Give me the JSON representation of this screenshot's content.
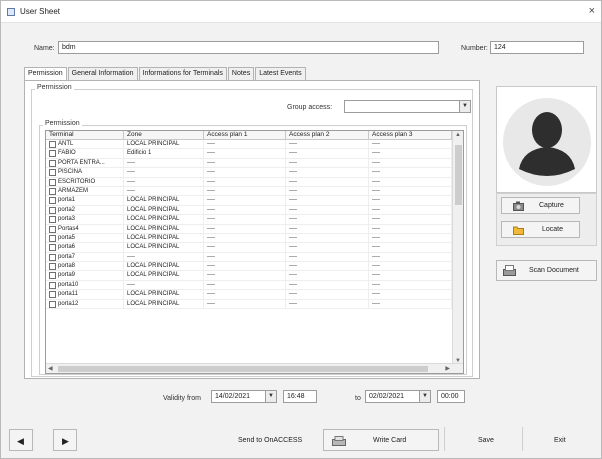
{
  "window": {
    "title": "User Sheet",
    "close_glyph": "×"
  },
  "header": {
    "name_label": "Name:",
    "name_value": "bdm",
    "number_label": "Number:",
    "number_value": "124"
  },
  "tabs": [
    {
      "label": "Permission"
    },
    {
      "label": "General Information"
    },
    {
      "label": "Informations for Terminals"
    },
    {
      "label": "Notes"
    },
    {
      "label": "Latest Events"
    }
  ],
  "permission": {
    "group_caption": "Permission",
    "group_access_label": "Group access:",
    "group_access_value": "",
    "inner_caption": "Permission",
    "columns": [
      "Terminal",
      "Zone",
      "Access plan 1",
      "Access plan 2",
      "Access plan 3"
    ],
    "rows": [
      {
        "terminal": "ANTL",
        "zone": "LOCAL PRINCIPAL",
        "p1": "----",
        "p2": "----",
        "p3": "----"
      },
      {
        "terminal": "FABIO",
        "zone": "Edificio 1",
        "p1": "----",
        "p2": "----",
        "p3": "----"
      },
      {
        "terminal": "PORTA ENTRA...",
        "zone": "----",
        "p1": "----",
        "p2": "----",
        "p3": "----"
      },
      {
        "terminal": "PISCINA",
        "zone": "----",
        "p1": "----",
        "p2": "----",
        "p3": "----"
      },
      {
        "terminal": "ESCRITORIO",
        "zone": "----",
        "p1": "----",
        "p2": "----",
        "p3": "----"
      },
      {
        "terminal": "ARMAZEM",
        "zone": "----",
        "p1": "----",
        "p2": "----",
        "p3": "----"
      },
      {
        "terminal": "porta1",
        "zone": "LOCAL PRINCIPAL",
        "p1": "----",
        "p2": "----",
        "p3": "----"
      },
      {
        "terminal": "porta2",
        "zone": "LOCAL PRINCIPAL",
        "p1": "----",
        "p2": "----",
        "p3": "----"
      },
      {
        "terminal": "porta3",
        "zone": "LOCAL PRINCIPAL",
        "p1": "----",
        "p2": "----",
        "p3": "----"
      },
      {
        "terminal": "Portas4",
        "zone": "LOCAL PRINCIPAL",
        "p1": "----",
        "p2": "----",
        "p3": "----"
      },
      {
        "terminal": "porta5",
        "zone": "LOCAL PRINCIPAL",
        "p1": "----",
        "p2": "----",
        "p3": "----"
      },
      {
        "terminal": "porta6",
        "zone": "LOCAL PRINCIPAL",
        "p1": "----",
        "p2": "----",
        "p3": "----"
      },
      {
        "terminal": "porta7",
        "zone": "----",
        "p1": "----",
        "p2": "----",
        "p3": "----"
      },
      {
        "terminal": "porta8",
        "zone": "LOCAL PRINCIPAL",
        "p1": "----",
        "p2": "----",
        "p3": "----"
      },
      {
        "terminal": "porta9",
        "zone": "LOCAL PRINCIPAL",
        "p1": "----",
        "p2": "----",
        "p3": "----"
      },
      {
        "terminal": "porta10",
        "zone": "----",
        "p1": "----",
        "p2": "----",
        "p3": "----"
      },
      {
        "terminal": "porta11",
        "zone": "LOCAL PRINCIPAL",
        "p1": "----",
        "p2": "----",
        "p3": "----"
      },
      {
        "terminal": "porta12",
        "zone": "LOCAL PRINCIPAL",
        "p1": "----",
        "p2": "----",
        "p3": "----"
      }
    ]
  },
  "validity": {
    "from_label": "Validity from",
    "from_date": "14/02/2021",
    "from_time": "16:48",
    "to_label": "to",
    "to_date": "02/02/2021",
    "to_time": "00:00"
  },
  "side": {
    "capture_label": "Capture",
    "locate_label": "Locate",
    "scan_label": "Scan Document"
  },
  "bottom": {
    "prev_glyph": "◀",
    "next_glyph": "▶",
    "send_label": "Send to OnACCESS",
    "write_label": "Write Card",
    "save_label": "Save",
    "exit_label": "Exit"
  },
  "icons": {
    "app": "user-sheet-icon",
    "avatar": "person-silhouette-icon",
    "capture": "camera-icon",
    "locate": "folder-icon",
    "scan": "scanner-icon",
    "write": "card-reader-icon"
  }
}
